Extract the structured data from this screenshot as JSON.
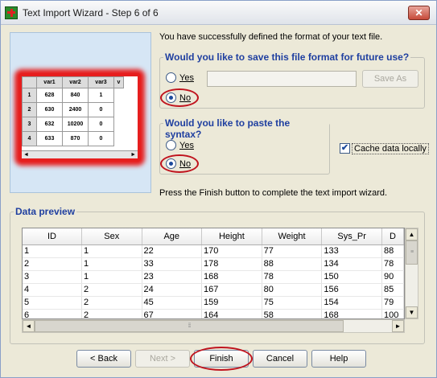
{
  "window": {
    "title": "Text Import Wizard - Step 6 of 6",
    "close_glyph": "✕"
  },
  "illustration": {
    "headers": [
      "var1",
      "var2",
      "var3",
      "v"
    ],
    "rows": [
      [
        "1",
        "628",
        "840",
        "1"
      ],
      [
        "2",
        "630",
        "2400",
        "0"
      ],
      [
        "3",
        "632",
        "10200",
        "0"
      ],
      [
        "4",
        "633",
        "870",
        "0"
      ]
    ],
    "scroll_left": "◄",
    "scroll_right": "►"
  },
  "message": "You have successfully defined the format of your text file.",
  "save_format": {
    "question": "Would you like to save this file format for future use?",
    "yes_label": "Yes",
    "no_label": "No",
    "selected": "No",
    "filename_value": "",
    "save_as_label": "Save As"
  },
  "paste_syntax": {
    "question": "Would you like to paste the syntax?",
    "yes_label": "Yes",
    "no_label": "No",
    "selected": "No"
  },
  "cache": {
    "label": "Cache data locally",
    "checked": true,
    "check_glyph": "✔"
  },
  "finish_note": "Press the Finish button to complete the text import wizard.",
  "preview": {
    "title": "Data preview",
    "columns": [
      "ID",
      "Sex",
      "Age",
      "Height",
      "Weight",
      "Sys_Pr",
      "D"
    ],
    "rows": [
      [
        "1",
        "1",
        "22",
        "170",
        "77",
        "133",
        "88"
      ],
      [
        "2",
        "1",
        "33",
        "178",
        "88",
        "134",
        "78"
      ],
      [
        "3",
        "1",
        "23",
        "168",
        "78",
        "150",
        "90"
      ],
      [
        "4",
        "2",
        "24",
        "167",
        "80",
        "156",
        "85"
      ],
      [
        "5",
        "2",
        "45",
        "159",
        "75",
        "154",
        "79"
      ],
      [
        "6",
        "2",
        "67",
        "164",
        "58",
        "168",
        "100"
      ]
    ]
  },
  "buttons": {
    "back": "< Back",
    "next": "Next >",
    "finish": "Finish",
    "cancel": "Cancel",
    "help": "Help"
  },
  "accent_colors": {
    "legend_blue": "#1f3fa0",
    "highlight_red": "#c0141e"
  }
}
